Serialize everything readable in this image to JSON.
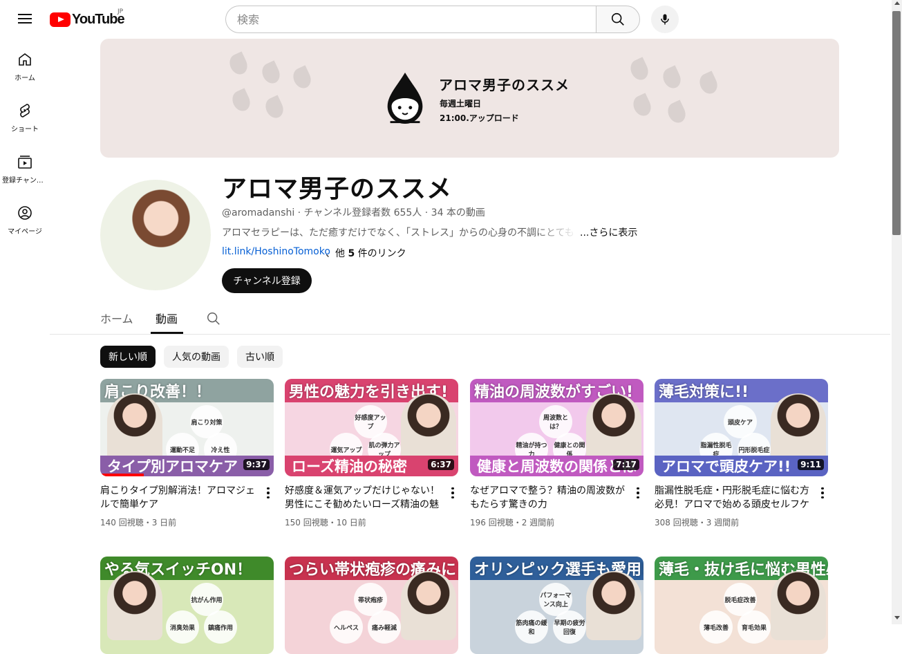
{
  "colors": {
    "accent": "#ff0000",
    "link": "#065fd4",
    "text": "#0f0f0f",
    "muted": "#606060",
    "banner_bg": "#efe6e4"
  },
  "header": {
    "logo_text": "YouTube",
    "region": "JP",
    "search_placeholder": "検索",
    "icons": [
      "menu-icon",
      "search-icon",
      "microphone-icon"
    ]
  },
  "sidebar": {
    "items": [
      {
        "label": "ホーム",
        "icon": "home-icon"
      },
      {
        "label": "ショート",
        "icon": "shorts-icon"
      },
      {
        "label": "登録チャンネル",
        "icon": "subscriptions-icon"
      },
      {
        "label": "マイページ",
        "icon": "my-page-icon"
      }
    ]
  },
  "banner": {
    "title": "アロマ男子のススメ",
    "line1": "毎週土曜日",
    "line2": "21:00.アップロード"
  },
  "channel": {
    "name": "アロマ男子のススメ",
    "meta": "@aromadanshi · チャンネル登録者数 655人 · 34 本の動画",
    "description": "アロマセラピーは、ただ癒すだけでなく、「ストレス」からの心身の不調にとても",
    "description_more": "...さらに表示",
    "link": "lit.link/HoshinoTomoko",
    "link_more_prefix": "、他 ",
    "link_more_count": "5",
    "link_more_suffix": " 件のリンク",
    "subscribe_label": "チャンネル登録"
  },
  "tabs": [
    {
      "label": "ホーム",
      "active": false
    },
    {
      "label": "動画",
      "active": true
    }
  ],
  "chips": [
    {
      "label": "新しい順",
      "active": true
    },
    {
      "label": "人気の動画",
      "active": false
    },
    {
      "label": "古い順",
      "active": false
    }
  ],
  "videos": [
    {
      "thumb_title": "肩こり改善！！",
      "thumb_caption": "タイプ別アロマケア",
      "bubbles": [
        "肩こり対策",
        "運動不足",
        "冷え性"
      ],
      "duration": "9:37",
      "watched_fraction": 0.25,
      "title": "肩こりタイプ別解消法！アロマジェルで簡単ケア",
      "meta": "140 回視聴・3 日前",
      "bg": "#eef1ee",
      "title_bg": "#8fa3a0",
      "caption_bg": "#8a5ea8"
    },
    {
      "thumb_title": "男性の魅力を引き出す!",
      "thumb_caption": "ローズ精油の秘密",
      "bubbles": [
        "好感度アップ",
        "運気アップ",
        "肌の弾力アップ"
      ],
      "duration": "6:37",
      "watched_fraction": 0,
      "title": "好感度＆運気アップだけじゃない！男性にこそ勧めたいローズ精油の魅力",
      "meta": "150 回視聴・10 日前",
      "bg": "#f6d6e2",
      "title_bg": "#d9436f",
      "caption_bg": "#d9436f"
    },
    {
      "thumb_title": "精油の周波数がすごい!",
      "thumb_caption": "健康と周波数の関係とは",
      "bubbles": [
        "周波数とは？",
        "精油が持つ力",
        "健康との関係"
      ],
      "duration": "7:17",
      "watched_fraction": 0,
      "title": "なぜアロマで整う？精油の周波数がもたらす驚きの力",
      "meta": "196 回視聴・2 週間前",
      "bg": "#f2c9ec",
      "title_bg": "#c05ac0",
      "caption_bg": "#c05ac0"
    },
    {
      "thumb_title": "薄毛対策に!!",
      "thumb_caption": "アロマで頭皮ケア!!",
      "bubbles": [
        "頭皮ケア",
        "脂漏性脱毛症",
        "円形脱毛症"
      ],
      "duration": "9:11",
      "watched_fraction": 0,
      "title": "脂漏性脱毛症・円形脱毛症に悩む方必見！アロマで始める頭皮セルフケア",
      "meta": "308 回視聴・3 週間前",
      "bg": "#dfe6f1",
      "title_bg": "#6b6fc9",
      "caption_bg": "#5a63c2"
    },
    {
      "thumb_title": "やる気スイッチON！",
      "thumb_caption": "",
      "bubbles": [
        "抗がん作用",
        "消臭効果",
        "鎮痛作用"
      ],
      "duration": "",
      "watched_fraction": 0,
      "title": "",
      "meta": "",
      "bg": "#d8e8b8",
      "title_bg": "#3f8a2a",
      "caption_bg": "#3f8a2a"
    },
    {
      "thumb_title": "つらい帯状疱疹の痛みに",
      "thumb_caption": "",
      "bubbles": [
        "帯状疱疹",
        "ヘルペス",
        "痛み軽減"
      ],
      "duration": "",
      "watched_fraction": 0,
      "title": "",
      "meta": "",
      "bg": "#f4d3d8",
      "title_bg": "#c8324f",
      "caption_bg": "#c8324f"
    },
    {
      "thumb_title": "オリンピック選手も愛用!?",
      "thumb_caption": "",
      "bubbles": [
        "パフォーマンス向上",
        "筋肉痛の緩和",
        "早期の疲労回復"
      ],
      "duration": "",
      "watched_fraction": 0,
      "title": "",
      "meta": "",
      "bg": "#c9d3dc",
      "title_bg": "#2f5f9a",
      "caption_bg": "#2f5f9a"
    },
    {
      "thumb_title": "薄毛・抜け毛に悩む男性必見",
      "thumb_caption": "",
      "bubbles": [
        "脱毛症改善",
        "薄毛改善",
        "育毛効果"
      ],
      "duration": "",
      "watched_fraction": 0,
      "title": "",
      "meta": "",
      "bg": "#f3e1d6",
      "title_bg": "#3e9a4a",
      "caption_bg": "#3e9a4a"
    }
  ]
}
